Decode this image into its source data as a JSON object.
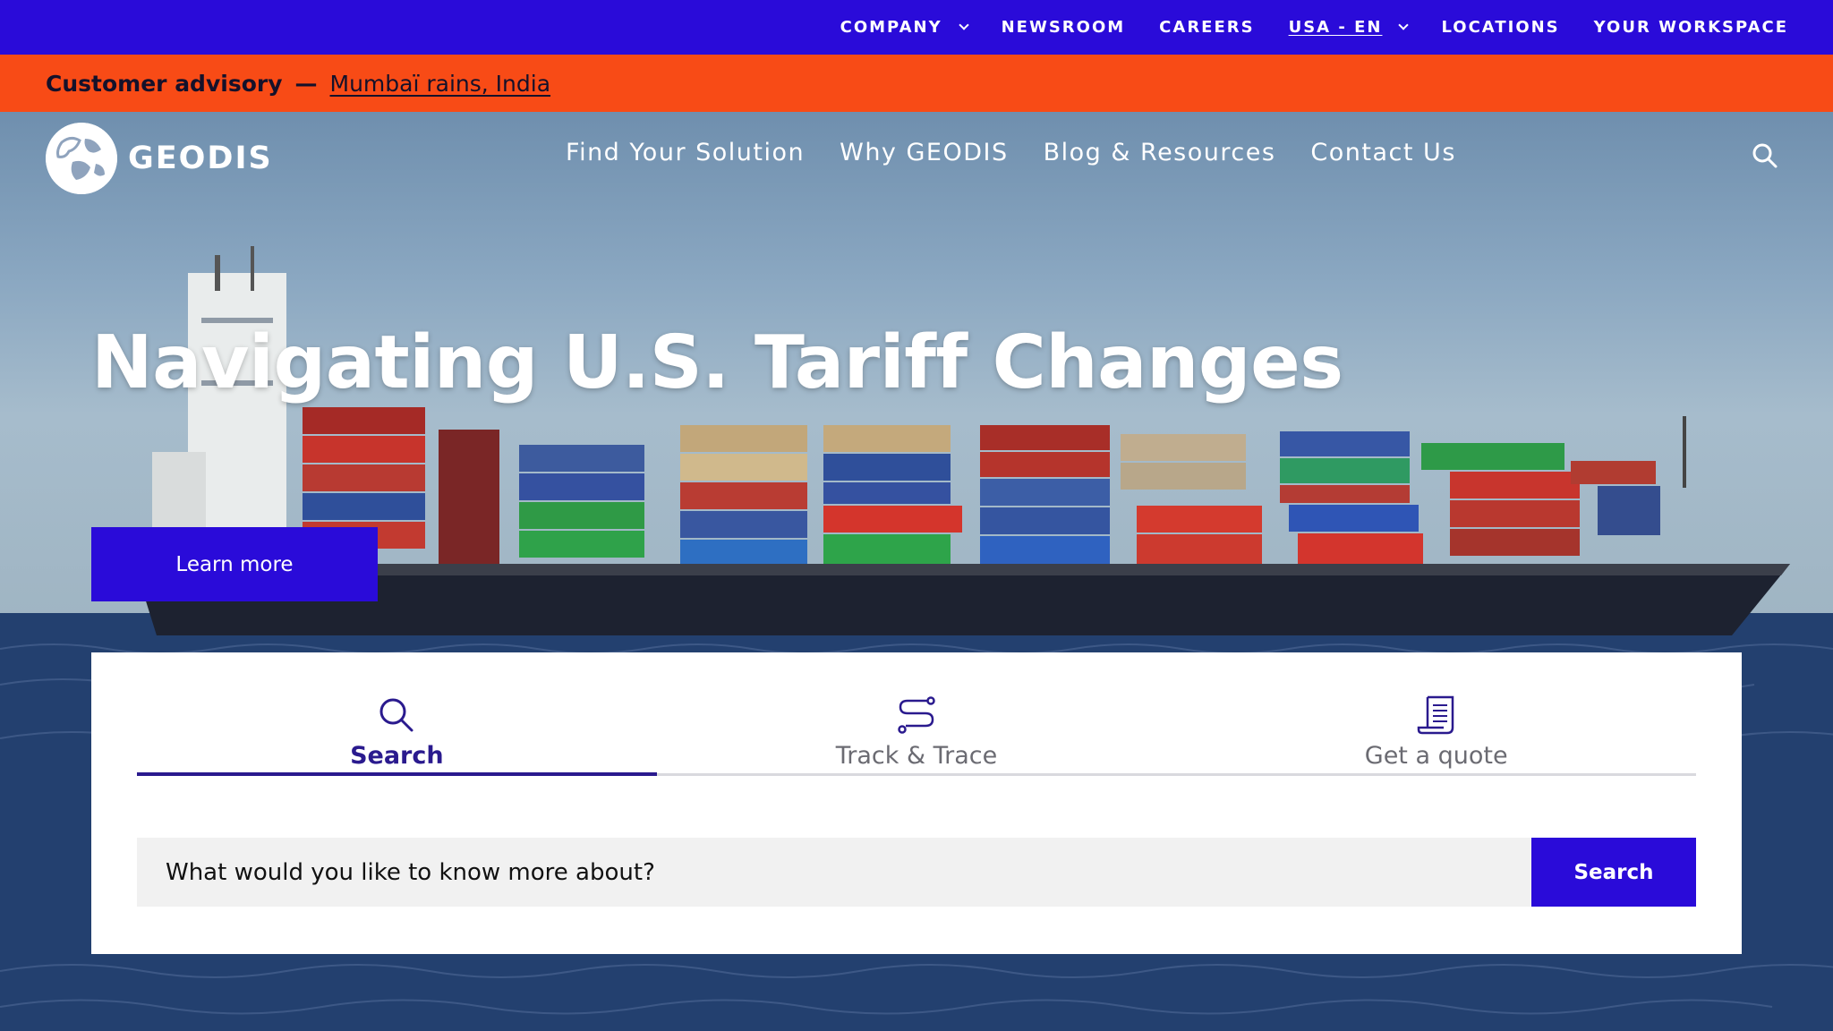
{
  "topbar": {
    "items": [
      {
        "label": "COMPANY",
        "has_dropdown": true
      },
      {
        "label": "NEWSROOM",
        "has_dropdown": false
      },
      {
        "label": "CAREERS",
        "has_dropdown": false
      },
      {
        "label": "USA - EN",
        "has_dropdown": true
      },
      {
        "label": "LOCATIONS",
        "has_dropdown": false
      },
      {
        "label": "YOUR WORKSPACE",
        "has_dropdown": false
      }
    ]
  },
  "advisory": {
    "title": "Customer advisory",
    "separator": "—",
    "link": "Mumbaï rains, India"
  },
  "brand": {
    "name": "GEODIS",
    "accent": "#2a0bd9",
    "advisory_color": "#f84b16"
  },
  "mainnav": {
    "items": [
      "Find Your Solution",
      "Why GEODIS",
      "Blog & Resources",
      "Contact Us"
    ],
    "search_icon": "search-icon"
  },
  "hero": {
    "title": "Navigating U.S. Tariff Changes",
    "cta": "Learn more"
  },
  "panel": {
    "tabs": [
      {
        "label": "Search",
        "icon": "search-icon",
        "active": true
      },
      {
        "label": "Track & Trace",
        "icon": "route-icon",
        "active": false
      },
      {
        "label": "Get a quote",
        "icon": "document-icon",
        "active": false
      }
    ],
    "search": {
      "placeholder": "What would you like to know more about?",
      "button": "Search"
    }
  }
}
